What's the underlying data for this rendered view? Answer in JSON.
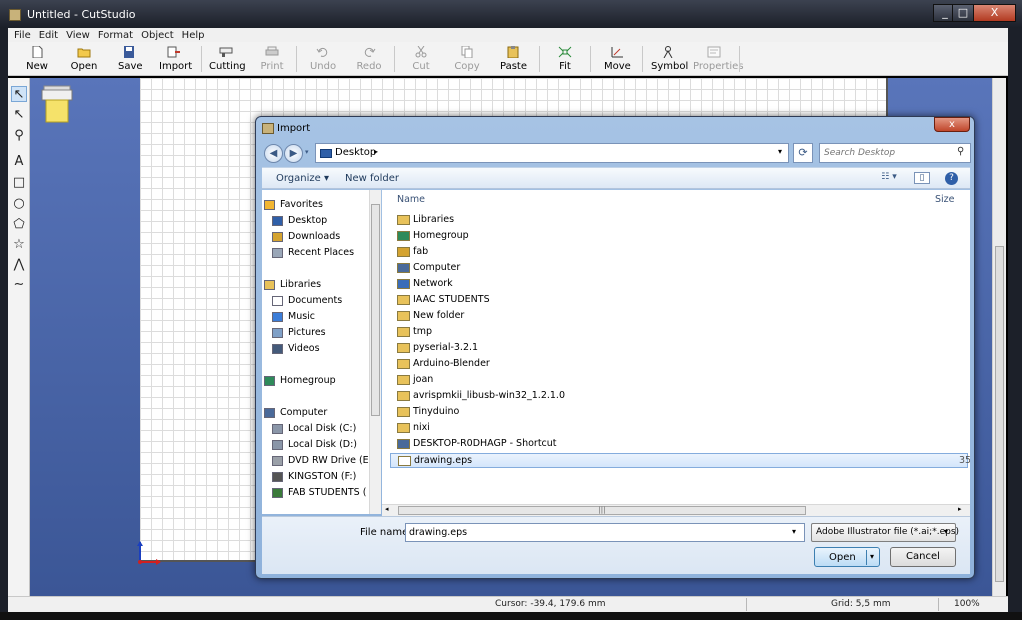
{
  "window": {
    "title": "Untitled - CutStudio",
    "min": "_",
    "max": "□",
    "close": "X"
  },
  "menu": [
    "File",
    "Edit",
    "View",
    "Format",
    "Object",
    "Help"
  ],
  "toolbar": [
    {
      "label": "New",
      "icon": "new-document-icon",
      "enabled": true
    },
    {
      "label": "Open",
      "icon": "open-folder-icon",
      "enabled": true
    },
    {
      "label": "Save",
      "icon": "floppy-disk-icon",
      "enabled": true
    },
    {
      "label": "Import",
      "icon": "import-icon",
      "enabled": true
    },
    {
      "label": "Cutting",
      "icon": "cutter-icon",
      "enabled": true
    },
    {
      "label": "Print",
      "icon": "printer-icon",
      "enabled": false
    },
    {
      "label": "Undo",
      "icon": "undo-icon",
      "enabled": false
    },
    {
      "label": "Redo",
      "icon": "redo-icon",
      "enabled": false
    },
    {
      "label": "Cut",
      "icon": "scissors-icon",
      "enabled": false
    },
    {
      "label": "Copy",
      "icon": "copy-icon",
      "enabled": false
    },
    {
      "label": "Paste",
      "icon": "paste-icon",
      "enabled": true
    },
    {
      "label": "Fit",
      "icon": "fit-icon",
      "enabled": true
    },
    {
      "label": "Move",
      "icon": "move-icon",
      "enabled": true
    },
    {
      "label": "Symbol",
      "icon": "symbol-icon",
      "enabled": true
    },
    {
      "label": "Properties",
      "icon": "properties-icon",
      "enabled": false
    }
  ],
  "tools": {
    "select": "↖",
    "node": "↖",
    "zoom": "⚲",
    "text": "A",
    "rect": "□",
    "ellipse": "○",
    "polygon": "⬠",
    "star": "☆",
    "polyline": "⋀",
    "curve": "∼"
  },
  "status": {
    "cursor": "Cursor: -39.4, 179.6 mm",
    "grid": "Grid: 5,5 mm",
    "zoom": "100%"
  },
  "dialog": {
    "title": "Import",
    "close": "x",
    "address": {
      "location": "Desktop",
      "arrow": "▸",
      "dropdown": "▾"
    },
    "search_placeholder": "Search Desktop",
    "organize": "Organize ▾",
    "new_folder": "New folder",
    "view_menu": "☷ ▾",
    "help": "?",
    "nav": [
      {
        "label": "Favorites",
        "icon": "star-icon",
        "indent": 0
      },
      {
        "label": "Desktop",
        "icon": "desktop-icon",
        "indent": 1
      },
      {
        "label": "Downloads",
        "icon": "downloads-icon",
        "indent": 1
      },
      {
        "label": "Recent Places",
        "icon": "recent-places-icon",
        "indent": 1
      },
      {
        "label": "Libraries",
        "icon": "libraries-icon",
        "indent": 0
      },
      {
        "label": "Documents",
        "icon": "documents-icon",
        "indent": 1
      },
      {
        "label": "Music",
        "icon": "music-icon",
        "indent": 1
      },
      {
        "label": "Pictures",
        "icon": "pictures-icon",
        "indent": 1
      },
      {
        "label": "Videos",
        "icon": "videos-icon",
        "indent": 1
      },
      {
        "label": "Homegroup",
        "icon": "homegroup-icon",
        "indent": 0
      },
      {
        "label": "Computer",
        "icon": "computer-icon",
        "indent": 0
      },
      {
        "label": "Local Disk (C:)",
        "icon": "disk-icon",
        "indent": 1
      },
      {
        "label": "Local Disk (D:)",
        "icon": "disk-icon",
        "indent": 1
      },
      {
        "label": "DVD RW Drive (E:",
        "icon": "dvd-icon",
        "indent": 1
      },
      {
        "label": "KINGSTON (F:)",
        "icon": "usb-drive-icon",
        "indent": 1
      },
      {
        "label": "FAB STUDENTS (",
        "icon": "network-drive-icon",
        "indent": 1
      }
    ],
    "columns": {
      "name": "Name",
      "size": "Size"
    },
    "files": [
      {
        "name": "Libraries",
        "icon": "libraries-icon",
        "selected": false,
        "size": ""
      },
      {
        "name": "Homegroup",
        "icon": "homegroup-icon",
        "selected": false,
        "size": ""
      },
      {
        "name": "fab",
        "icon": "user-folder-icon",
        "selected": false,
        "size": ""
      },
      {
        "name": "Computer",
        "icon": "computer-icon",
        "selected": false,
        "size": ""
      },
      {
        "name": "Network",
        "icon": "network-icon",
        "selected": false,
        "size": ""
      },
      {
        "name": "IAAC  STUDENTS",
        "icon": "folder-icon",
        "selected": false,
        "size": ""
      },
      {
        "name": "New folder",
        "icon": "folder-icon",
        "selected": false,
        "size": ""
      },
      {
        "name": "tmp",
        "icon": "folder-icon",
        "selected": false,
        "size": ""
      },
      {
        "name": "pyserial-3.2.1",
        "icon": "folder-icon",
        "selected": false,
        "size": ""
      },
      {
        "name": "Arduino-Blender",
        "icon": "folder-icon",
        "selected": false,
        "size": ""
      },
      {
        "name": "joan",
        "icon": "folder-icon",
        "selected": false,
        "size": ""
      },
      {
        "name": "avrispmkii_libusb-win32_1.2.1.0",
        "icon": "folder-icon",
        "selected": false,
        "size": ""
      },
      {
        "name": "Tinyduino",
        "icon": "folder-icon",
        "selected": false,
        "size": ""
      },
      {
        "name": "nixi",
        "icon": "folder-icon",
        "selected": false,
        "size": ""
      },
      {
        "name": "DESKTOP-R0DHAGP - Shortcut",
        "icon": "shortcut-icon",
        "selected": false,
        "size": ""
      },
      {
        "name": "drawing.eps",
        "icon": "file-icon",
        "selected": true,
        "size": "35"
      }
    ],
    "file_name_label": "File name:",
    "file_name_value": "drawing.eps",
    "file_type": "Adobe Illustrator file (*.ai;*.eps)",
    "open_label": "Open",
    "cancel_label": "Cancel"
  },
  "colors": {
    "workspace": "#4a67a9",
    "dialog_frame": "#9bbbe0",
    "selection": "#d4e6fb"
  }
}
